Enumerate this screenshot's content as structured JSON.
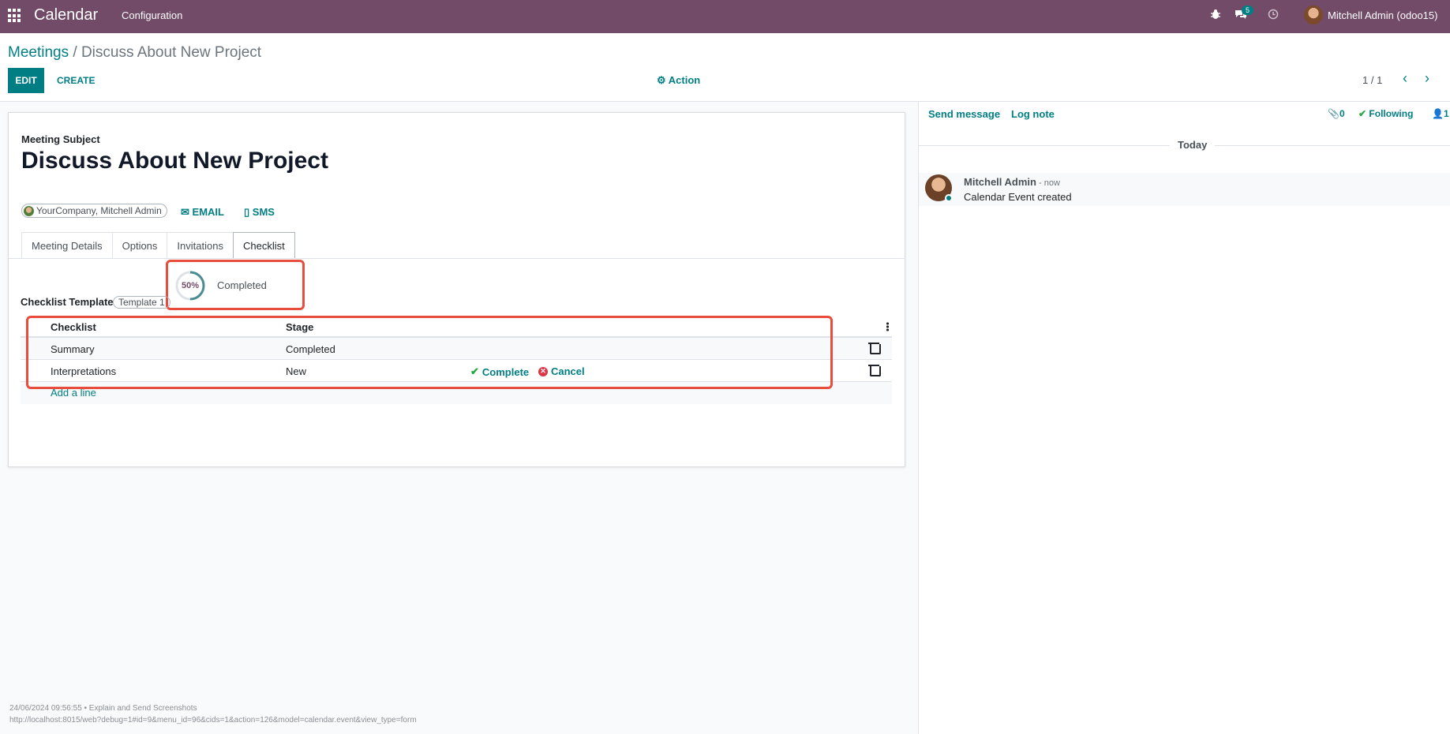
{
  "navbar": {
    "brand": "Calendar",
    "menu_configuration": "Configuration",
    "messages_count": "5",
    "user_name": "Mitchell Admin (odoo15)"
  },
  "breadcrumb": {
    "parent": "Meetings",
    "separator": " / ",
    "current": "Discuss About New Project"
  },
  "control": {
    "edit_label": "EDIT",
    "create_label": "CREATE",
    "action_label": "Action",
    "pager_value": "1 / 1"
  },
  "form": {
    "subject_label": "Meeting Subject",
    "subject": "Discuss About New Project",
    "attendees_tag": "YourCompany, Mitchell Admin",
    "email_label": "EMAIL",
    "sms_label": "SMS",
    "tabs": [
      "Meeting Details",
      "Options",
      "Invitations",
      "Checklist"
    ],
    "active_tab": "Checklist"
  },
  "checklist": {
    "progress_value": 0.5,
    "progress_label": "50%",
    "progress_text": "Completed",
    "template_label": "Checklist Template",
    "template_value": "Template 1",
    "columns": [
      "Checklist",
      "Stage"
    ],
    "rows": [
      {
        "name": "Summary",
        "stage": "Completed"
      },
      {
        "name": "Interpretations",
        "stage": "New",
        "complete_label": "Complete",
        "cancel_label": "Cancel"
      }
    ],
    "add_line": "Add a line"
  },
  "chatter": {
    "send_message": "Send message",
    "log_note": "Log note",
    "attachments_count": "0",
    "following_label": "Following",
    "followers_count": "1",
    "today_label": "Today",
    "messages": [
      {
        "author": "Mitchell Admin",
        "date": "- now",
        "body": "Calendar Event created"
      }
    ]
  },
  "footer": {
    "line1": "24/06/2024 09:56:55 • Explain and Send Screenshots",
    "line2": "http://localhost:8015/web?debug=1#id=9&menu_id=96&cids=1&action=126&model=calendar.event&view_type=form"
  },
  "colors": {
    "brand": "#714b67",
    "primary": "#017e84",
    "highlight": "#e74c3c"
  }
}
